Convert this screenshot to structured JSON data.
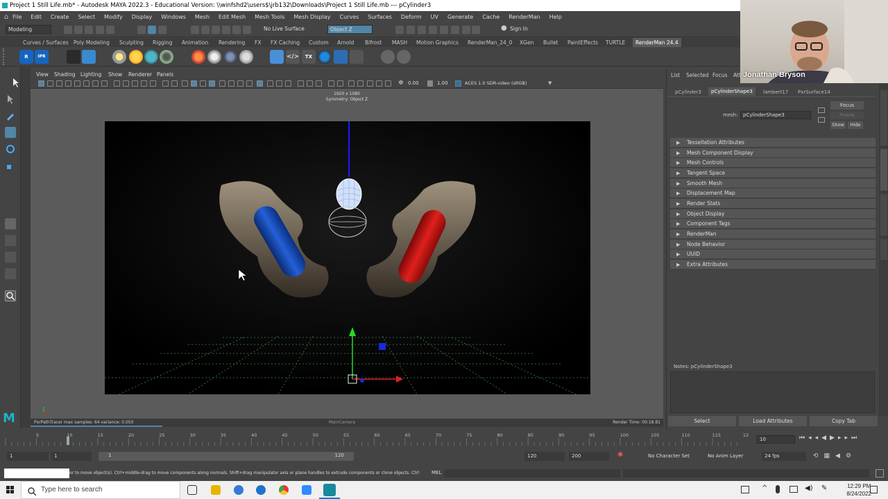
{
  "window": {
    "title": "Project 1 Still Life.mb* - Autodesk MAYA 2022.3 - Educational Version: \\\\winfshd2\\users$\\jrb132\\Downloads\\Project 1 Still Life.mb   ---   pCylinder3"
  },
  "menubar": {
    "items": [
      "File",
      "Edit",
      "Create",
      "Select",
      "Modify",
      "Display",
      "Windows",
      "Mesh",
      "Edit Mesh",
      "Mesh Tools",
      "Mesh Display",
      "Curves",
      "Surfaces",
      "Deform",
      "UV",
      "Generate",
      "Cache",
      "RenderMan",
      "Help"
    ]
  },
  "statusline": {
    "mode": "Modeling",
    "live_surface": "No Live Surface",
    "symmetry": "Object Z",
    "sign_in": "Sign In"
  },
  "shelf": {
    "tabs": [
      "Curves / Surfaces",
      "Poly Modeling",
      "Sculpting",
      "Rigging",
      "Animation",
      "Rendering",
      "FX",
      "FX Caching",
      "Custom",
      "Arnold",
      "Bifrost",
      "MASH",
      "Motion Graphics",
      "RenderMan_24_0",
      "XGen",
      "Bullet",
      "PaintEffects",
      "TURTLE",
      "RenderMan 24.4"
    ],
    "active_tab": "RenderMan 24.4",
    "ipr_label": "IPR"
  },
  "panel": {
    "menus": [
      "View",
      "Shading",
      "Lighting",
      "Show",
      "Renderer",
      "Panels"
    ],
    "exposure": "0.00",
    "gamma": "1.00",
    "colorspace": "ACES 1.0 SDR-video (sRGB)"
  },
  "viewport": {
    "resolution": "1920 x 1080",
    "symmetry_label": "Symmetry: Object Z",
    "renderer_status": "PxrPathTracer  max samples: 64  variance: 0.050",
    "camera": "MainCamera",
    "render_time": "Render Time: 00:18.81"
  },
  "attribute_editor": {
    "top_tabs": [
      "List",
      "Selected",
      "Focus",
      "Att"
    ],
    "node_tabs": [
      "pCylinder3",
      "pCylinderShape3",
      "lambert17",
      "PxrSurface14"
    ],
    "active_node_tab": "pCylinderShape3",
    "mesh_label": "mesh:",
    "mesh_value": "pCylinderShape3",
    "focus_button": "Focus",
    "presets_label": "Presets",
    "show_button": "Show",
    "hide_button": "Hide",
    "sections": [
      "Tessellation Attributes",
      "Mesh Component Display",
      "Mesh Controls",
      "Tangent Space",
      "Smooth Mesh",
      "Displacement Map",
      "Render Stats",
      "Object Display",
      "Component Tags",
      "RenderMan",
      "Node Behavior",
      "UUID",
      "Extra Attributes"
    ],
    "notes": "Notes:  pCylinderShape3",
    "buttons": [
      "Select",
      "Load Attributes",
      "Copy Tab"
    ],
    "side_tabs": [
      "Channel Box / Layer Editor",
      "Attribute Editor",
      "Modeling Toolkit",
      "XGen"
    ]
  },
  "webcam": {
    "name": "Jonathan Bryson"
  },
  "timeline": {
    "ticks": [
      "5",
      "10",
      "15",
      "20",
      "25",
      "30",
      "35",
      "40",
      "45",
      "50",
      "55",
      "60",
      "65",
      "70",
      "75",
      "80",
      "85",
      "90",
      "95",
      "100",
      "105",
      "110",
      "115",
      "12"
    ],
    "current_frame": "10",
    "range_start": "1",
    "range_start_inner": "1",
    "range_slider_start": "1",
    "range_slider_end": "120",
    "range_end_inner": "120",
    "range_end": "200",
    "character_set": "No Character Set",
    "anim_layer": "No Anim Layer",
    "fps": "24 fps"
  },
  "help_line": {
    "text": "or to move object(s). Ctrl+middle-drag to move components along normals. Shift+drag manipulator axis or plane handles to extrude components or clone objects. Ctrl+Shi",
    "mel_label": "MEL"
  },
  "taskbar": {
    "search_placeholder": "Type here to search",
    "time": "12:29 PM",
    "date": "8/24/2022"
  },
  "colors": {
    "maya_bg": "#444444",
    "viewport_bg": "#5b5b5b",
    "highlight": "#5285a6",
    "red_cylinder": "#e0201c",
    "blue_cylinder": "#1f50c0"
  }
}
